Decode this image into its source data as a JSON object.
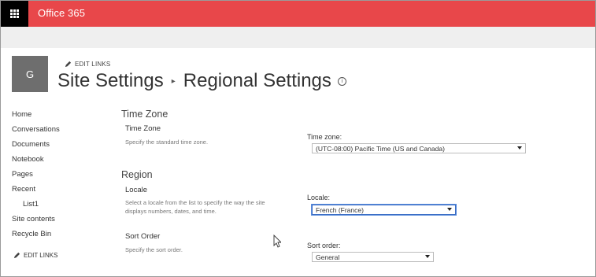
{
  "header": {
    "brand": "Office 365"
  },
  "site": {
    "tile_letter": "G",
    "edit_links": "EDIT LINKS"
  },
  "breadcrumb": {
    "parent": "Site Settings",
    "current": "Regional Settings"
  },
  "nav": {
    "items": [
      "Home",
      "Conversations",
      "Documents",
      "Notebook",
      "Pages",
      "Recent",
      "List1",
      "Site contents",
      "Recycle Bin"
    ],
    "edit_links": "EDIT LINKS"
  },
  "timezone_section": {
    "heading": "Time Zone",
    "group_title": "Time Zone",
    "description": "Specify the standard time zone.",
    "field_label": "Time zone:",
    "selected": "(UTC-08:00) Pacific Time (US and Canada)"
  },
  "region_section": {
    "heading": "Region",
    "locale": {
      "group_title": "Locale",
      "description_line1": "Select a locale from the list to specify the way the site",
      "description_line2": "displays numbers, dates, and time.",
      "field_label": "Locale:",
      "selected": "French (France)"
    },
    "sort": {
      "group_title": "Sort Order",
      "description": "Specify the sort order.",
      "field_label": "Sort order:",
      "selected": "General"
    }
  }
}
